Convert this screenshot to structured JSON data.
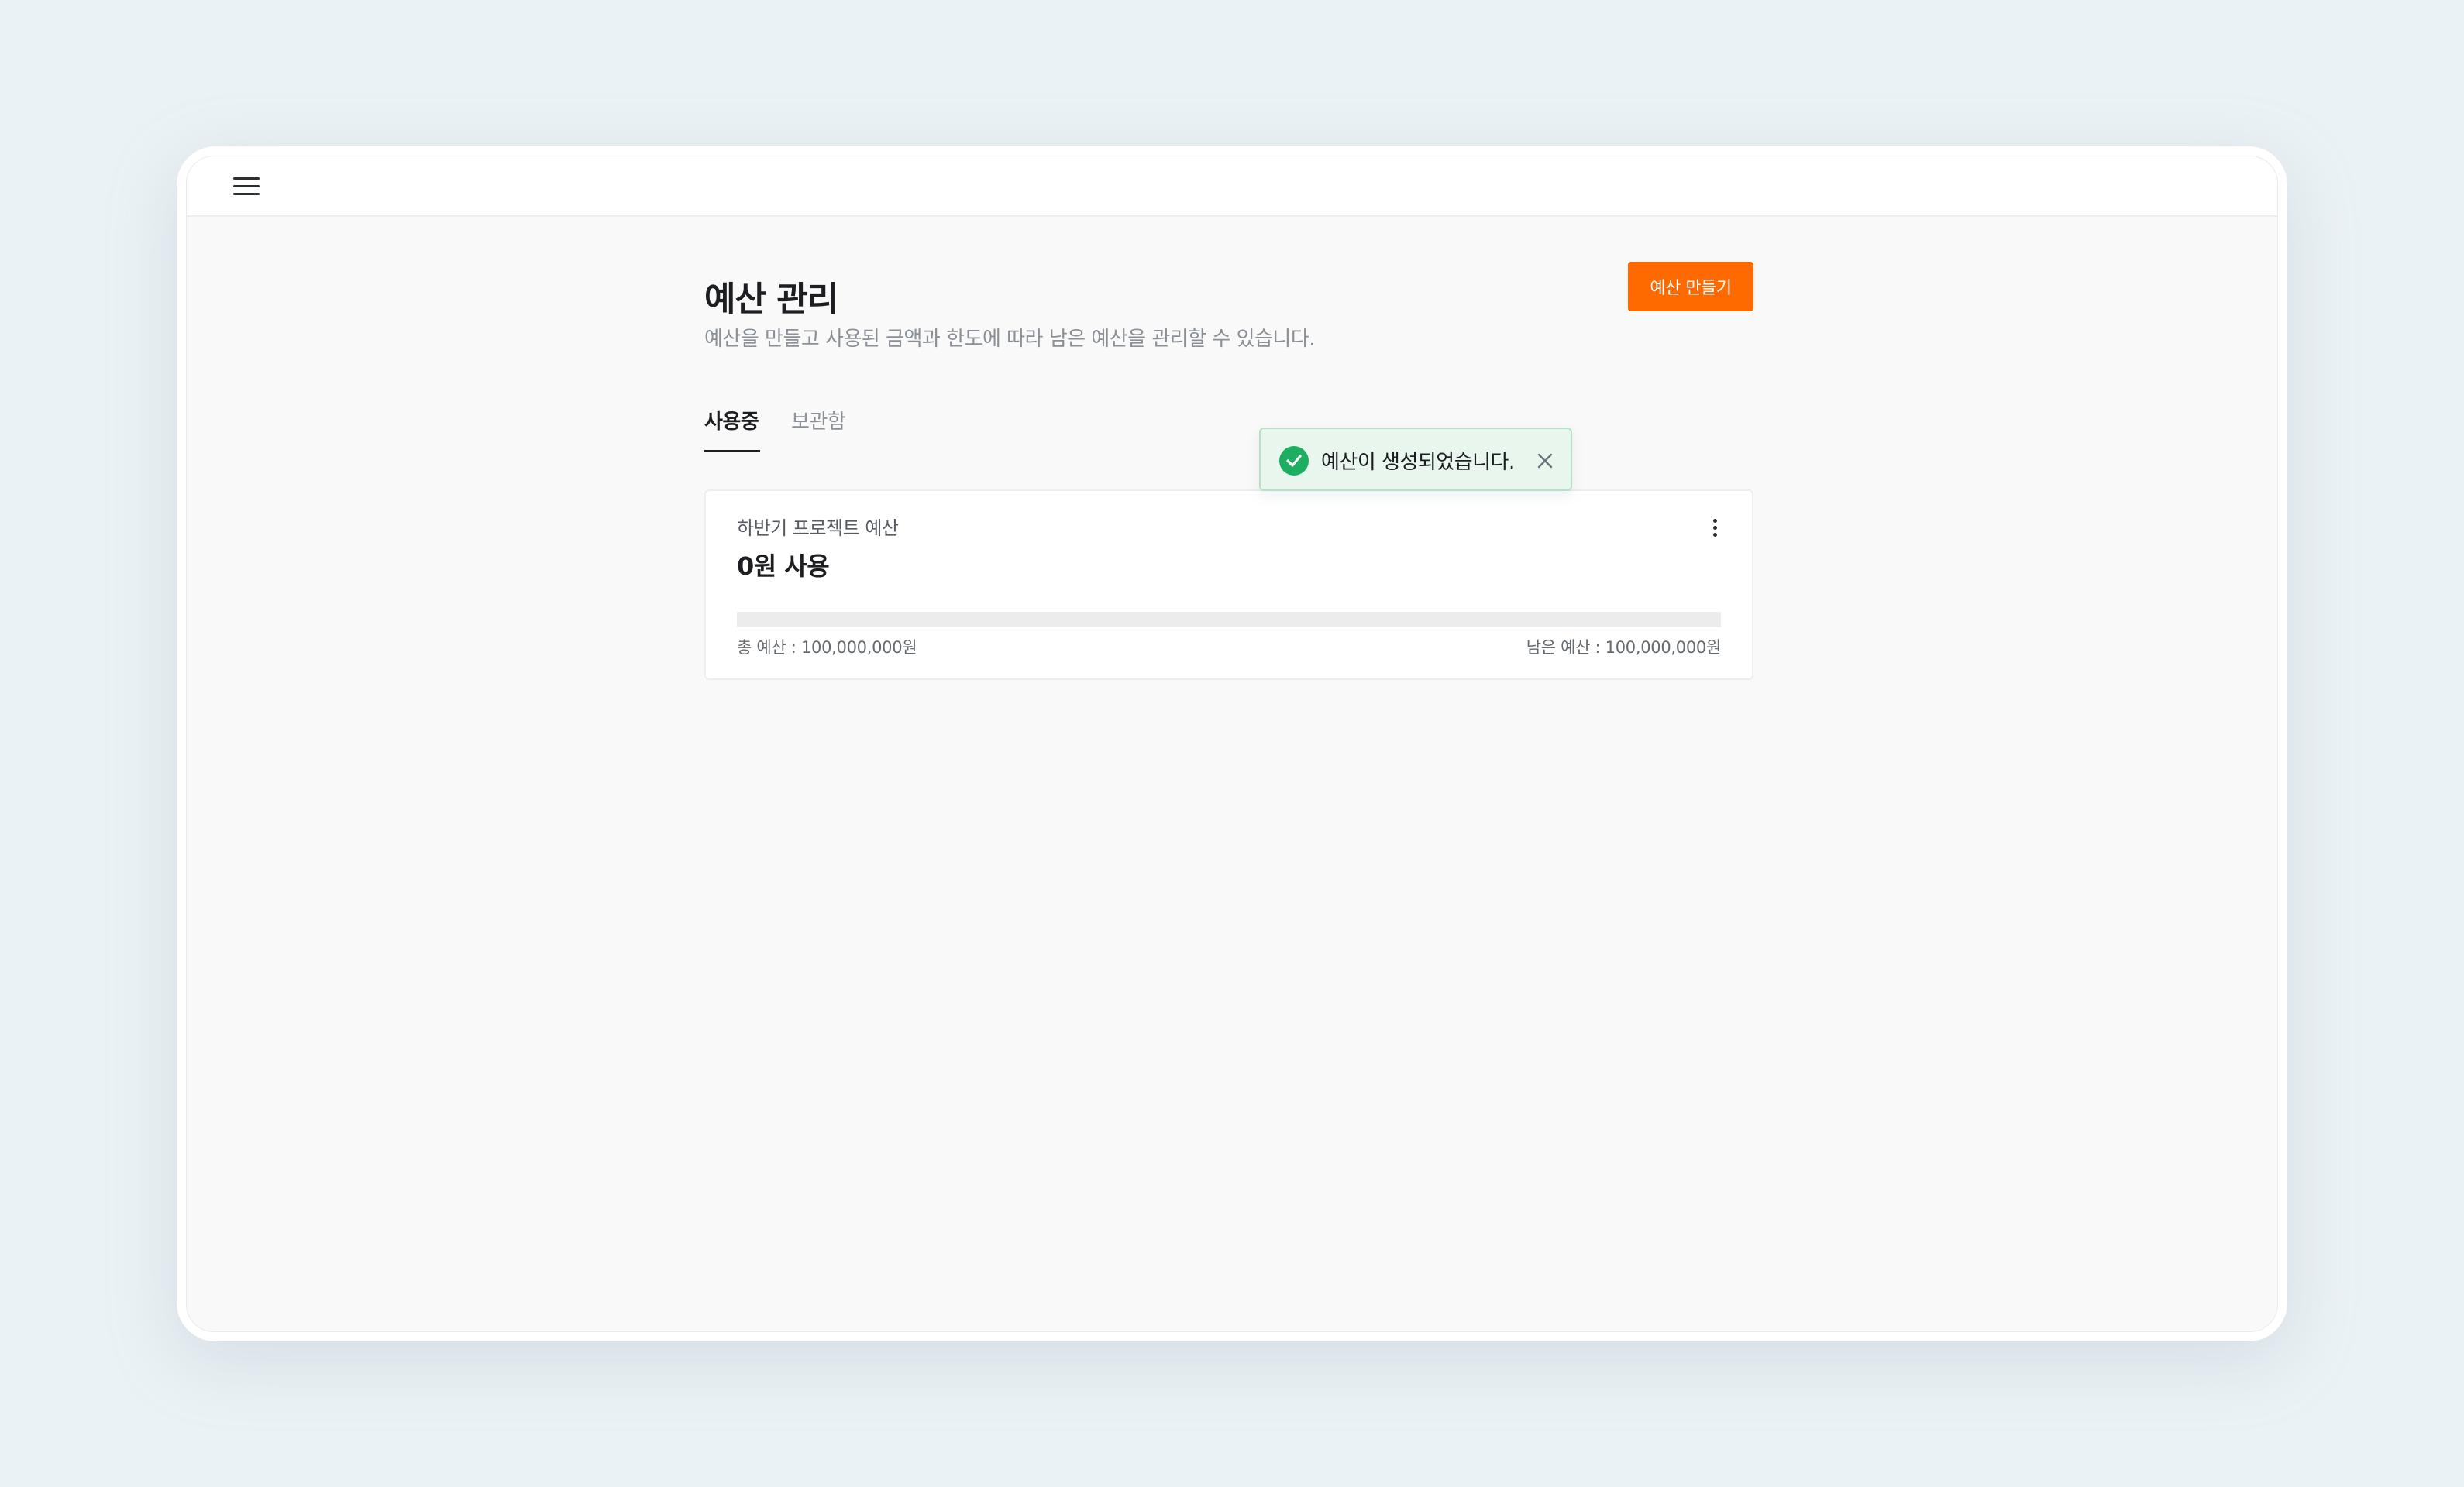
{
  "header": {
    "menu_icon": "hamburger-menu-icon"
  },
  "page": {
    "title": "예산 관리",
    "description": "예산을 만들고 사용된 금액과 한도에 따라 남은 예산을 관리할 수 있습니다.",
    "create_button_label": "예산 만들기"
  },
  "tabs": [
    {
      "label": "사용중",
      "active": true
    },
    {
      "label": "보관함",
      "active": false
    }
  ],
  "budget_card": {
    "name": "하반기 프로젝트 예산",
    "used_label": "0원 사용",
    "progress_fraction": 0,
    "total_label": "총 예산 : 100,000,000원",
    "remaining_label": "남은 예산 : 100,000,000원",
    "menu_icon": "more-vertical-icon"
  },
  "toast": {
    "message": "예산이 생성되었습니다.",
    "icon": "check-circle-icon",
    "close_icon": "close-icon",
    "color": "#1eae61"
  },
  "colors": {
    "accent": "#ff6a00",
    "success": "#1eae61",
    "background": "#ebf2f5"
  }
}
